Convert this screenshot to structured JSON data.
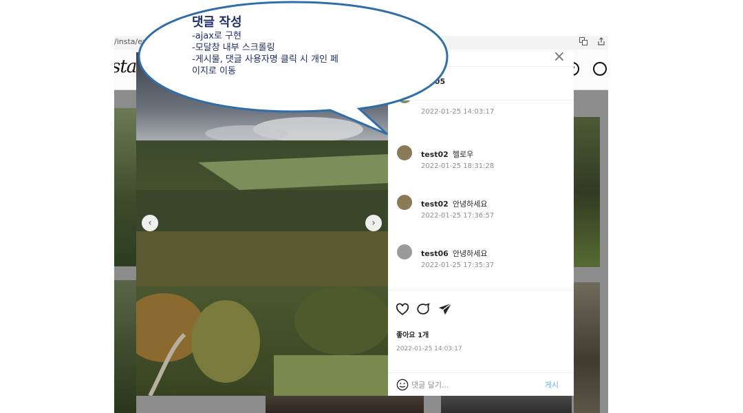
{
  "browser": {
    "url_text": "/insta/ex",
    "icons": [
      "translate-icon",
      "share-icon"
    ]
  },
  "page": {
    "logo": "stagr",
    "nav_icons": [
      "compass-icon",
      "search-icon"
    ]
  },
  "modal": {
    "author": "st05",
    "comments": [
      {
        "user": "",
        "text": "",
        "time": "2022-01-25 14:03:17",
        "avatar_color": "#7f8d5a"
      },
      {
        "user": "test02",
        "text": "헬로우",
        "time": "2022-01-25 18:31:28",
        "avatar_color": "#8a7a55"
      },
      {
        "user": "test02",
        "text": "안녕하세요",
        "time": "2022-01-25 17:36:57",
        "avatar_color": "#8a7a55"
      },
      {
        "user": "test06",
        "text": "안녕하세요",
        "time": "2022-01-25 17:35:37",
        "avatar_color": "#9a9a9a"
      }
    ],
    "likes": "좋아요 1개",
    "post_date": "2022-01-25 14:03:17",
    "comment_placeholder": "댓글 달기...",
    "post_button": "게시",
    "carousel": {
      "prev": "‹",
      "next": "›"
    },
    "close": "×",
    "action_icons": [
      "heart-icon",
      "comment-icon",
      "send-icon"
    ]
  },
  "annotation": {
    "title": "댓글 작성",
    "lines": [
      "-ajax로 구현",
      "-모달창 내부 스크롤링",
      "-게시물, 댓글 사용자명 클릭 시 개인 페",
      "이지로 이동"
    ],
    "fill": "#ffffff",
    "stroke": "#2f6ea8"
  }
}
